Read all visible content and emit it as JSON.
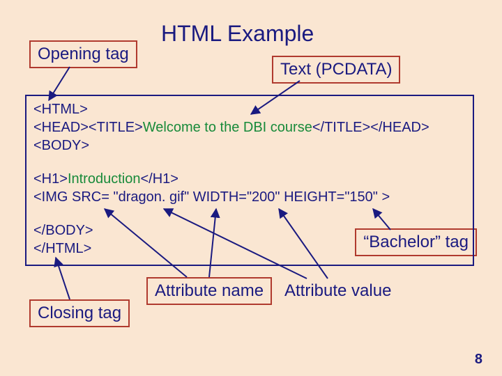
{
  "title": "HTML Example",
  "labels": {
    "opening": "Opening tag",
    "pcdata": "Text (PCDATA)",
    "bachelor": "“Bachelor” tag",
    "attrname": "Attribute name",
    "attrvalue": "Attribute value",
    "closing": "Closing tag"
  },
  "code": {
    "p1_a": "<HTML>\n<HEAD><TITLE>",
    "p1_pc": "Welcome to the DBI course",
    "p1_b": "</TITLE></HEAD>\n<BODY>",
    "p2_a": "<H1>",
    "p2_pc": "Introduction",
    "p2_b": "</H1>\n<IMG SRC= \"dragon. gif\" WIDTH=\"200\" HEIGHT=\"150\" >",
    "p3": "</BODY>\n</HTML>"
  },
  "page": "8"
}
